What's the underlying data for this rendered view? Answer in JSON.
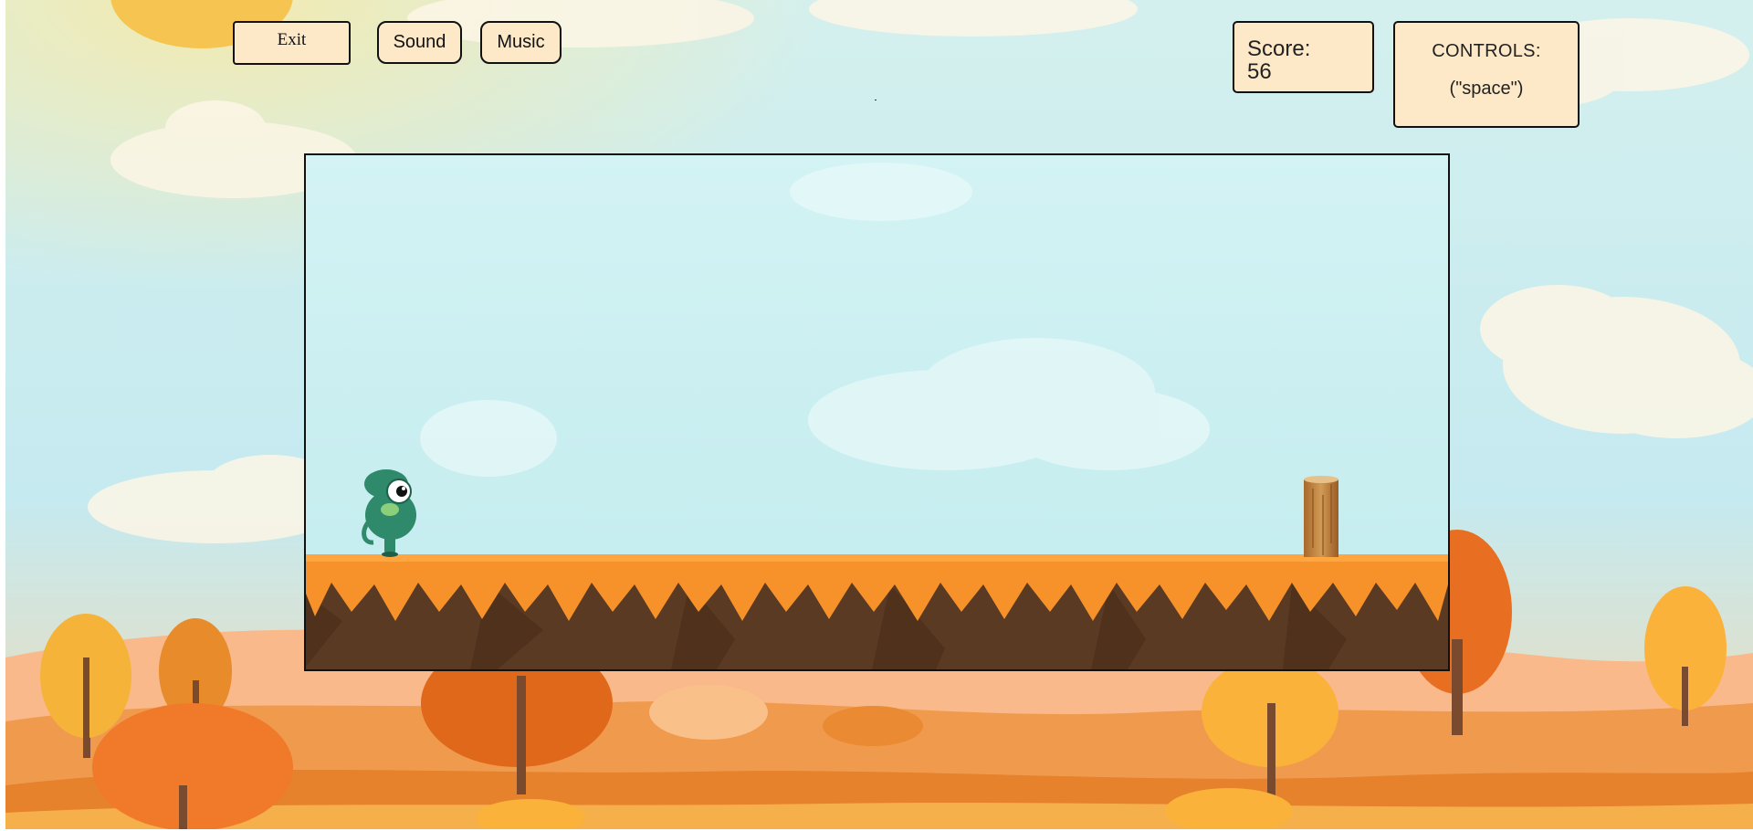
{
  "toolbar": {
    "exit_label": "Exit",
    "sound_label": "Sound",
    "music_label": "Music"
  },
  "score": {
    "label": "Score:",
    "value": "56"
  },
  "controls": {
    "title": "CONTROLS:",
    "key": "(\"space\")"
  },
  "game": {
    "player": "green-chameleon",
    "obstacle": "tree-stump"
  },
  "colors": {
    "sky": "#c9eef0",
    "panel_fill": "#fde9c8",
    "ground_top": "#f7922a",
    "ground_dirt": "#5a3a22",
    "player_green": "#2e8a6b"
  }
}
